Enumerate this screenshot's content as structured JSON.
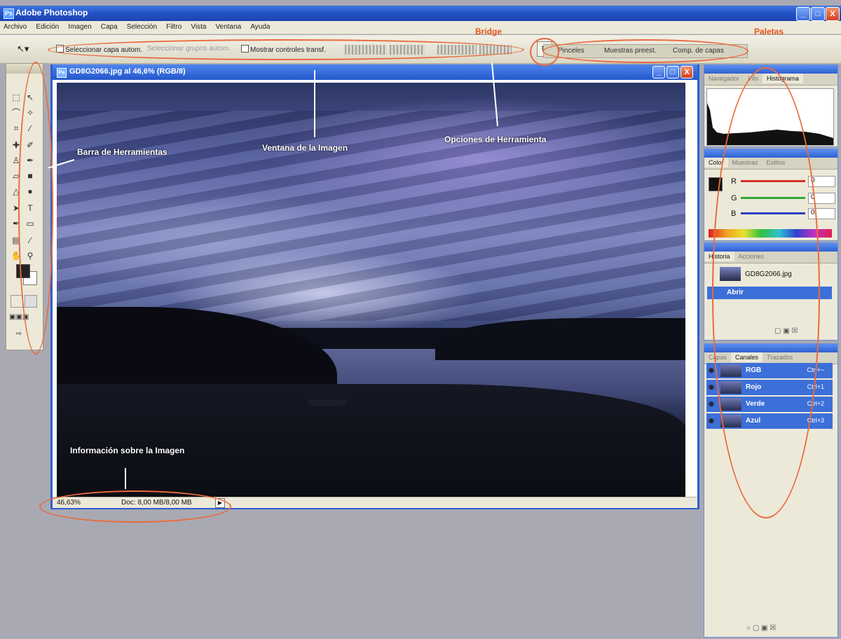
{
  "app": {
    "title": "Adobe Photoshop"
  },
  "window_controls": {
    "minimize": "_",
    "maximize": "□",
    "close": "X"
  },
  "menu": [
    "Archivo",
    "Edición",
    "Imagen",
    "Capa",
    "Selección",
    "Filtro",
    "Vista",
    "Ventana",
    "Ayuda"
  ],
  "options_bar": {
    "tool_icon": "move-tool-icon",
    "auto_select_layer": "Seleccionar capa autom.",
    "auto_select_groups": "Seleccionar grupos autom.",
    "show_transform_controls": "Mostrar controles transf."
  },
  "palette_well": {
    "tabs": [
      "Pinceles",
      "Muestras preest.",
      "Comp. de capas"
    ]
  },
  "document": {
    "title": "GD8G2066.jpg al 46,6% (RGB/8)",
    "zoom": "46,63%",
    "doc_info": "Doc: 8,00 MB/8,00 MB"
  },
  "palettes": {
    "navigator_group": {
      "tabs": [
        "Navegador",
        "Info",
        "Histograma"
      ],
      "active": "Histograma"
    },
    "color_group": {
      "tabs": [
        "Color",
        "Muestras",
        "Estilos"
      ],
      "channels": [
        {
          "label": "R",
          "value": "0",
          "color": "#d8322a"
        },
        {
          "label": "G",
          "value": "0",
          "color": "#2faa34"
        },
        {
          "label": "B",
          "value": "0",
          "color": "#2b3ec4"
        }
      ]
    },
    "history_group": {
      "tabs": [
        "Historia",
        "Acciones"
      ],
      "snapshot": "GD8G2066.jpg",
      "states": [
        "Abrir"
      ]
    },
    "layers_group": {
      "tabs": [
        "Capas",
        "Canales",
        "Trazados"
      ],
      "active": "Canales",
      "channels": [
        {
          "name": "RGB",
          "shortcut": "Ctrl+~"
        },
        {
          "name": "Rojo",
          "shortcut": "Ctrl+1"
        },
        {
          "name": "Verde",
          "shortcut": "Ctrl+2"
        },
        {
          "name": "Azul",
          "shortcut": "Ctrl+3"
        }
      ]
    }
  },
  "annotations": {
    "bridge": "Bridge",
    "paletas": "Paletas",
    "barra_herramientas": "Barra de Herramientas",
    "ventana_imagen": "Ventana de la Imagen",
    "opciones_herramienta": "Opciones de Herramienta",
    "info_imagen": "Información sobre la Imagen"
  },
  "colors": {
    "title_bar": "#2452c6",
    "annotation_red": "#e5541e",
    "selection_blue": "#3d6fd8"
  }
}
